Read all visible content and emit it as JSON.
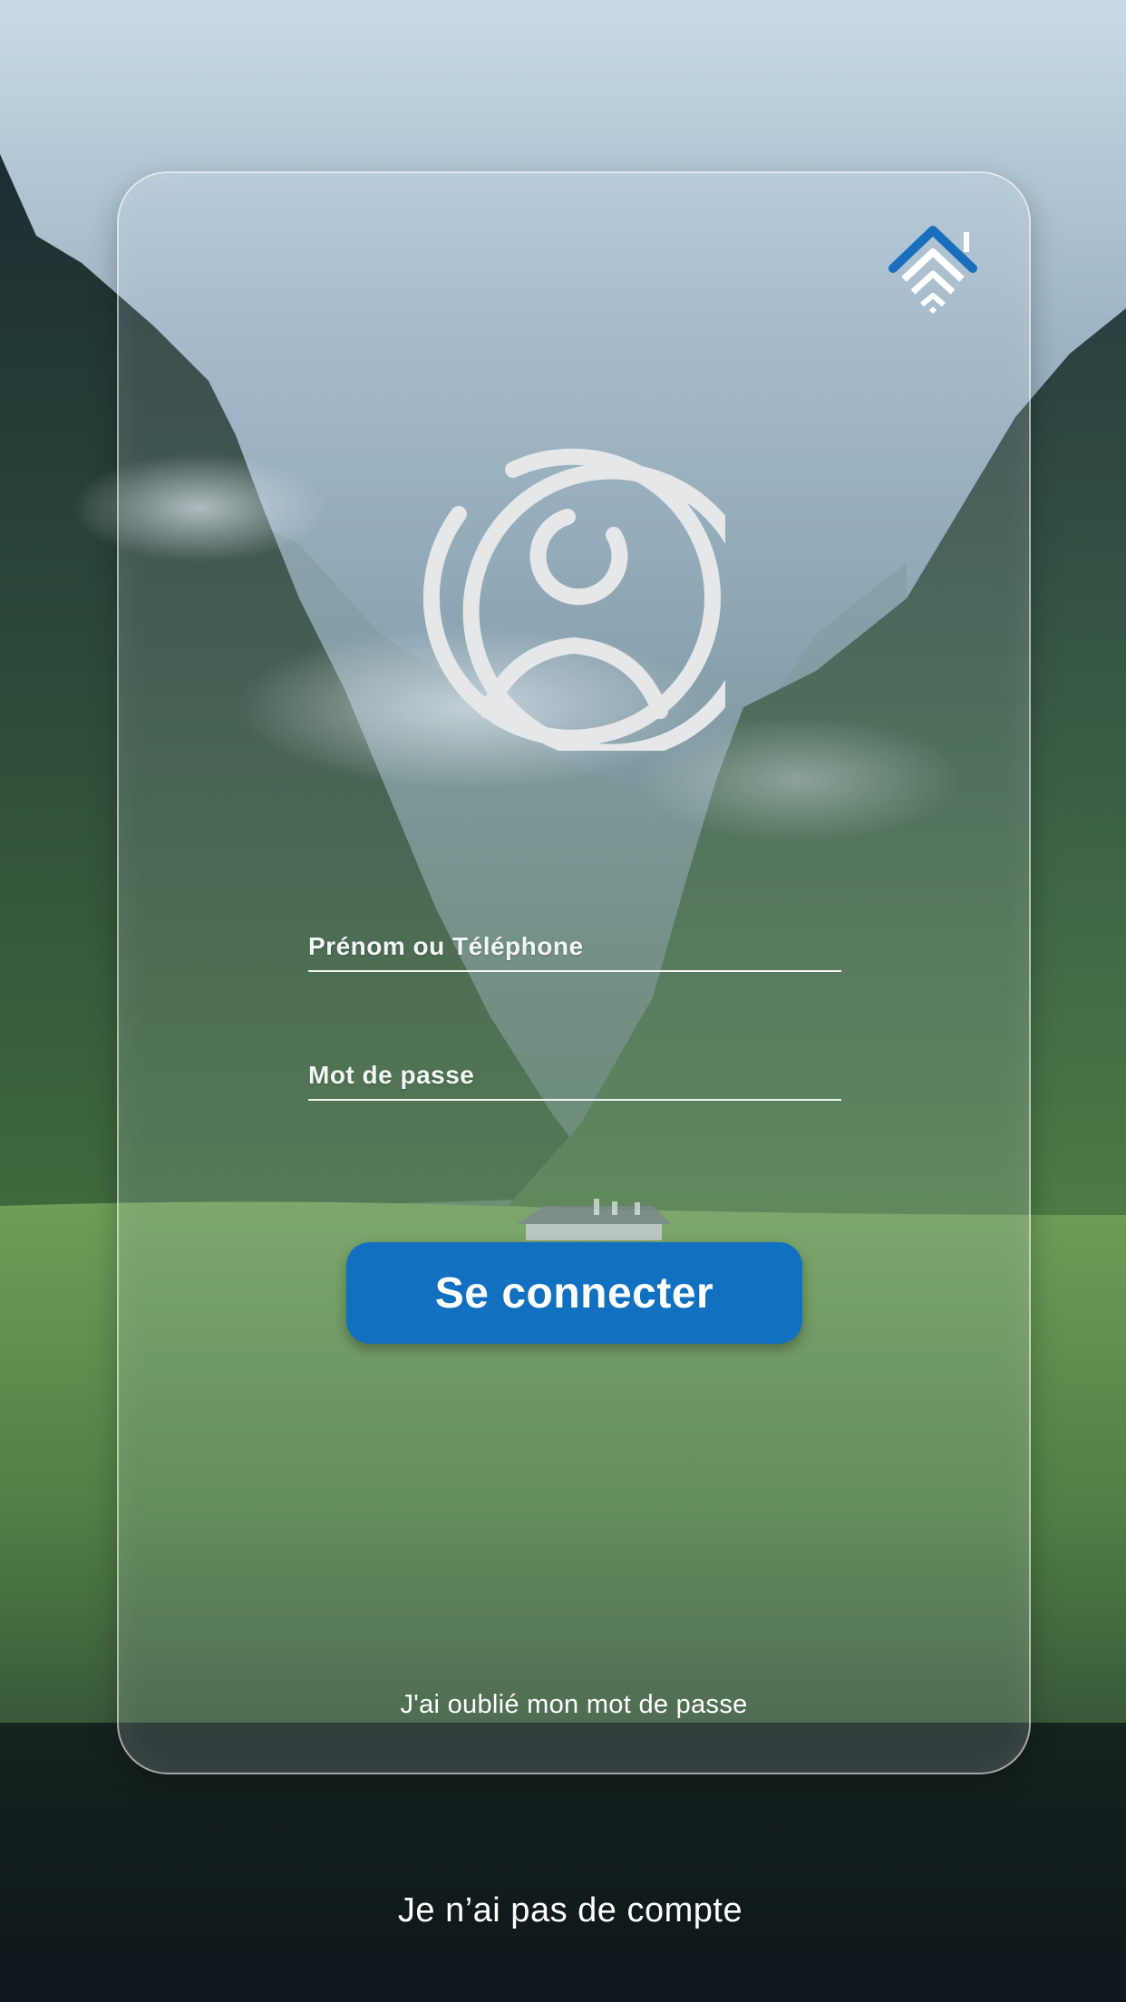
{
  "login_form": {
    "username_label": "Prénom ou Téléphone",
    "password_label": "Mot de passe",
    "submit_label": "Se connecter",
    "forgot_password_label": "J'ai oublié mon mot de passe"
  },
  "footer": {
    "signup_label": "Je n’ai pas de compte"
  },
  "icons": {
    "logo": "house-chevrons-logo-icon",
    "avatar": "user-avatar-icon"
  },
  "colors": {
    "accent": "#1170bf",
    "text": "#ffffff",
    "avatar_stroke": "#e6e7e9"
  }
}
